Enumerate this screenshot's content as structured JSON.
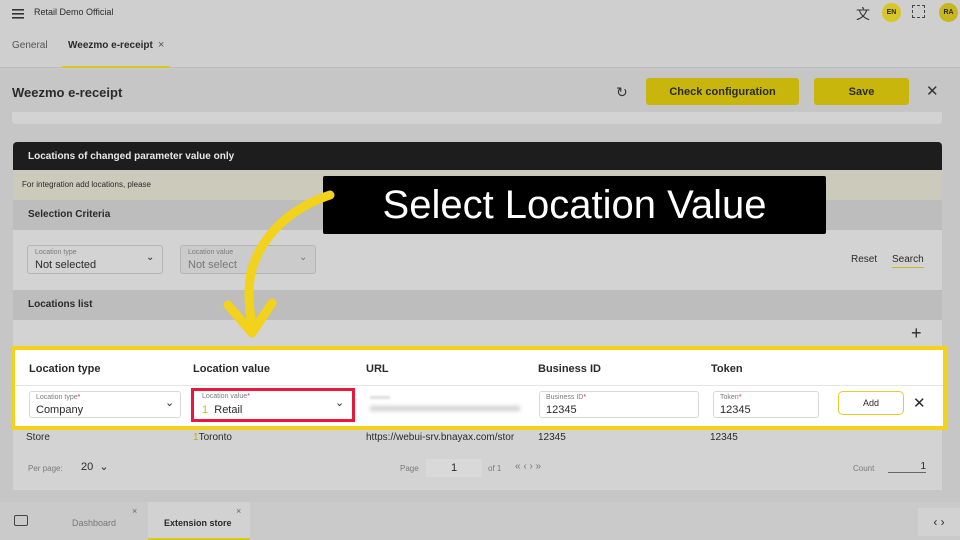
{
  "app": {
    "title": "Retail Demo Official",
    "lang": "EN",
    "user_initials": "RA"
  },
  "tabs": [
    {
      "label": "General"
    },
    {
      "label": "Weezmo e-receipt",
      "close": "×"
    }
  ],
  "page": {
    "title": "Weezmo e-receipt",
    "check_label": "Check configuration",
    "save_label": "Save"
  },
  "locations_panel": {
    "header": "Locations of changed parameter value only",
    "info": "For integration add locations, please",
    "criteria_title": "Selection Criteria",
    "filter_type": {
      "label": "Location type",
      "value": "Not selected"
    },
    "filter_value": {
      "label": "Location value",
      "value": "Not select"
    },
    "reset": "Reset",
    "search": "Search",
    "list_title": "Locations list",
    "add_symbol": "+"
  },
  "overlay": {
    "text": "Select Location Value"
  },
  "table": {
    "columns": [
      "Location type",
      "Location value",
      "URL",
      "Business ID",
      "Token"
    ],
    "edit_row": {
      "type_label": "Location type",
      "type_value": "Company",
      "value_label": "Location value",
      "value_num": "1",
      "value_text": "Retail",
      "business_label": "Business ID",
      "business_value": "12345",
      "token_label": "Token",
      "token_value": "12345",
      "add_label": "Add"
    },
    "rows": [
      {
        "type": "Store",
        "value_num": "1",
        "value_text": "Toronto",
        "url": "https://webui-srv.bnayax.com/stor",
        "business": "12345",
        "token": "12345"
      }
    ]
  },
  "pagination": {
    "per_page_label": "Per page:",
    "per_page": "20",
    "page_label": "Page",
    "page": "1",
    "of": "of 1",
    "count_label": "Count",
    "count": "1"
  },
  "bottom": {
    "tabs": [
      {
        "label": "Dashboard"
      },
      {
        "label": "Extension store"
      }
    ]
  },
  "colors": {
    "accent": "#f2d21b",
    "highlight": "#e8173c",
    "banner": "#000000"
  }
}
